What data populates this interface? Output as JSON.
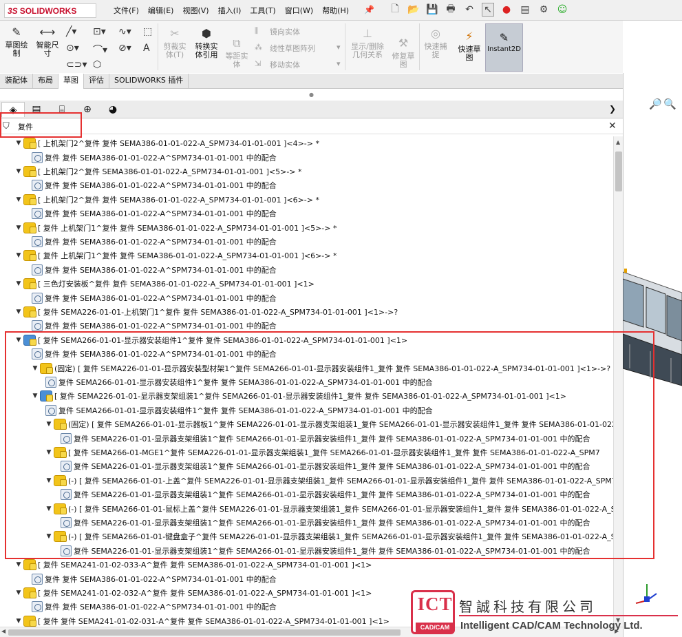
{
  "app": {
    "logo_ds": "3S",
    "logo_text": "SOLIDWORKS"
  },
  "menu": [
    "文件(F)",
    "编辑(E)",
    "视图(V)",
    "插入(I)",
    "工具(T)",
    "窗口(W)",
    "帮助(H)"
  ],
  "ribbon": {
    "sketch": "草图绘\n制",
    "smart_dim": "智能尺\n寸",
    "trim": "剪裁实\n体(T)",
    "convert": "转换实\n体引用",
    "offset": "等距实\n体",
    "mirror": "镜向实体",
    "linear_pattern": "线性草图阵列",
    "move": "移动实体",
    "show_relations": "显示/删除\n几何关系",
    "repair": "修复草\n图",
    "quick_snap": "快速捕\n捉",
    "rapid_sketch": "快速草\n图",
    "instant2d": "Instant2D"
  },
  "command_tabs": [
    "装配体",
    "布局",
    "草图",
    "评估",
    "SOLIDWORKS 插件"
  ],
  "filter": {
    "value": "复件"
  },
  "tree": [
    {
      "level": 1,
      "type": "asm",
      "text": "[ 上机架门2^复件 复件 SEMA386-01-01-022-A_SPM734-01-01-001 ]<4>-> *"
    },
    {
      "level": 2,
      "type": "mate",
      "text": "复件 复件 SEMA386-01-01-022-A^SPM734-01-01-001 中的配合"
    },
    {
      "level": 1,
      "type": "asm",
      "text": "[ 上机架门2^复件 SEMA386-01-01-022-A_SPM734-01-01-001 ]<5>-> *"
    },
    {
      "level": 2,
      "type": "mate",
      "text": "复件 复件 SEMA386-01-01-022-A^SPM734-01-01-001 中的配合"
    },
    {
      "level": 1,
      "type": "asm",
      "text": "[ 上机架门2^复件 复件 SEMA386-01-01-022-A_SPM734-01-01-001 ]<6>-> *"
    },
    {
      "level": 2,
      "type": "mate",
      "text": "复件 复件 SEMA386-01-01-022-A^SPM734-01-01-001 中的配合"
    },
    {
      "level": 1,
      "type": "asm",
      "text": "[ 复件 上机架门1^复件 复件 SEMA386-01-01-022-A_SPM734-01-01-001 ]<5>-> *"
    },
    {
      "level": 2,
      "type": "mate",
      "text": "复件 复件 SEMA386-01-01-022-A^SPM734-01-01-001 中的配合"
    },
    {
      "level": 1,
      "type": "asm",
      "text": "[ 复件 上机架门1^复件 复件 SEMA386-01-01-022-A_SPM734-01-01-001 ]<6>-> *"
    },
    {
      "level": 2,
      "type": "mate",
      "text": "复件 复件 SEMA386-01-01-022-A^SPM734-01-01-001 中的配合"
    },
    {
      "level": 1,
      "type": "asm",
      "text": "[ 三色灯安装板^复件 复件 SEMA386-01-01-022-A_SPM734-01-01-001 ]<1>"
    },
    {
      "level": 2,
      "type": "mate",
      "text": "复件 复件 SEMA386-01-01-022-A^SPM734-01-01-001 中的配合"
    },
    {
      "level": 1,
      "type": "asm",
      "text": "[ 复件 SEMA226-01-01-上机架门1^复件 复件 SEMA386-01-01-022-A_SPM734-01-01-001 ]<1>->?"
    },
    {
      "level": 2,
      "type": "mate",
      "text": "复件 复件 SEMA386-01-01-022-A^SPM734-01-01-001 中的配合"
    },
    {
      "level": 1,
      "type": "asmblue",
      "text": "[ 复件 SEMA266-01-01-显示器安装组件1^复件 复件 SEMA386-01-01-022-A_SPM734-01-01-001 ]<1>"
    },
    {
      "level": 2,
      "type": "mate",
      "text": "复件 复件 SEMA386-01-01-022-A^SPM734-01-01-001 中的配合"
    },
    {
      "level": 2,
      "type": "asm",
      "text": "(固定) [ 复件 SEMA226-01-01-显示器安装型材架1^复件 SEMA266-01-01-显示器安装组件1_复件 复件 SEMA386-01-01-022-A_SPM734-01-01-001 ]<1>->?"
    },
    {
      "level": 3,
      "type": "mate",
      "text": "复件 SEMA266-01-01-显示器安装组件1^复件 复件 SEMA386-01-01-022-A_SPM734-01-01-001 中的配合"
    },
    {
      "level": 2,
      "type": "asmblue",
      "text": "[ 复件 SEMA226-01-01-显示器支架组装1^复件 SEMA266-01-01-显示器安装组件1_复件 复件 SEMA386-01-01-022-A_SPM734-01-01-001 ]<1>"
    },
    {
      "level": 3,
      "type": "mate",
      "text": "复件 SEMA266-01-01-显示器安装组件1^复件 复件 SEMA386-01-01-022-A_SPM734-01-01-001 中的配合"
    },
    {
      "level": 3,
      "type": "asm",
      "text": "(固定) [ 复件 SEMA266-01-01-显示器板1^复件 SEMA226-01-01-显示器支架组装1_复件 SEMA266-01-01-显示器安装组件1_复件 复件 SEMA386-01-01-022"
    },
    {
      "level": 4,
      "type": "mate",
      "text": "复件 SEMA226-01-01-显示器支架组装1^复件 SEMA266-01-01-显示器安装组件1_复件 复件 SEMA386-01-01-022-A_SPM734-01-01-001 中的配合"
    },
    {
      "level": 3,
      "type": "asm",
      "text": "[ 复件 SEMA266-01-MGE1^复件 SEMA226-01-01-显示器支架组装1_复件 SEMA266-01-01-显示器安装组件1_复件 复件 SEMA386-01-01-022-A_SPM7"
    },
    {
      "level": 4,
      "type": "mate",
      "text": "复件 SEMA226-01-01-显示器支架组装1^复件 SEMA266-01-01-显示器安装组件1_复件 复件 SEMA386-01-01-022-A_SPM734-01-01-001 中的配合"
    },
    {
      "level": 3,
      "type": "asm",
      "text": "(-) [ 复件 SEMA266-01-01-上盖^复件 SEMA226-01-01-显示器支架组装1_复件 SEMA266-01-01-显示器安装组件1_复件 复件 SEMA386-01-01-022-A_SPM7"
    },
    {
      "level": 4,
      "type": "mate",
      "text": "复件 SEMA226-01-01-显示器支架组装1^复件 SEMA266-01-01-显示器安装组件1_复件 复件 SEMA386-01-01-022-A_SPM734-01-01-001 中的配合"
    },
    {
      "level": 3,
      "type": "asm",
      "text": "(-) [ 复件 SEMA266-01-01-鼠标上盖^复件 SEMA226-01-01-显示器支架组装1_复件 SEMA266-01-01-显示器安装组件1_复件 复件 SEMA386-01-01-022-A_S"
    },
    {
      "level": 4,
      "type": "mate",
      "text": "复件 SEMA226-01-01-显示器支架组装1^复件 SEMA266-01-01-显示器安装组件1_复件 复件 SEMA386-01-01-022-A_SPM734-01-01-001 中的配合"
    },
    {
      "level": 3,
      "type": "asm",
      "text": "(-) [ 复件 SEMA266-01-01-键盘盒子^复件 SEMA226-01-01-显示器支架组装1_复件 SEMA266-01-01-显示器安装组件1_复件 复件 SEMA386-01-01-022-A_S"
    },
    {
      "level": 4,
      "type": "mate",
      "text": "复件 SEMA226-01-01-显示器支架组装1^复件 SEMA266-01-01-显示器安装组件1_复件 复件 SEMA386-01-01-022-A_SPM734-01-01-001 中的配合"
    },
    {
      "level": 1,
      "type": "asm",
      "text": "[ 复件 SEMA241-01-02-033-A^复件 复件 SEMA386-01-01-022-A_SPM734-01-01-001 ]<1>"
    },
    {
      "level": 2,
      "type": "mate",
      "text": "复件 复件 SEMA386-01-01-022-A^SPM734-01-01-001 中的配合"
    },
    {
      "level": 1,
      "type": "asm",
      "text": "[ 复件 SEMA241-01-02-032-A^复件 复件 SEMA386-01-01-022-A_SPM734-01-01-001 ]<1>"
    },
    {
      "level": 2,
      "type": "mate",
      "text": "复件 复件 SEMA386-01-01-022-A^SPM734-01-01-001 中的配合"
    },
    {
      "level": 1,
      "type": "asm",
      "text": "[ 复件 复件 SEMA241-01-02-031-A^复件 复件 SEMA386-01-01-022-A_SPM734-01-01-001 ]<1>"
    }
  ],
  "watermark": {
    "logo": "ICT",
    "logo_sub": "CAD/CAM",
    "cn": "智誠科技有限公司",
    "en": "Intelligent CAD/CAM Technology Ltd."
  },
  "colors": {
    "highlight": "#e53030",
    "brand": "#c8102e"
  }
}
